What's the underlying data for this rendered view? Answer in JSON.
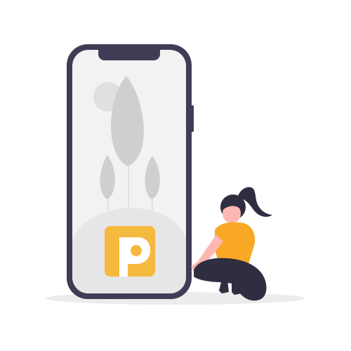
{
  "illustration": {
    "subject": "phone-with-app-logo-and-sitting-woman",
    "icons": [
      "smartphone-icon",
      "app-logo-icon",
      "plant-icon",
      "sun-icon",
      "person-icon"
    ],
    "colors": {
      "phone_frame": "#3f3d56",
      "phone_screen": "#f2f2f2",
      "foliage": "#cfcfcf",
      "ground": "#e6e6e6",
      "logo_accent": "#f5b93f",
      "shirt": "#f9a826",
      "skin": "#fdb7b2",
      "hair_and_pants": "#2f2e41"
    }
  }
}
